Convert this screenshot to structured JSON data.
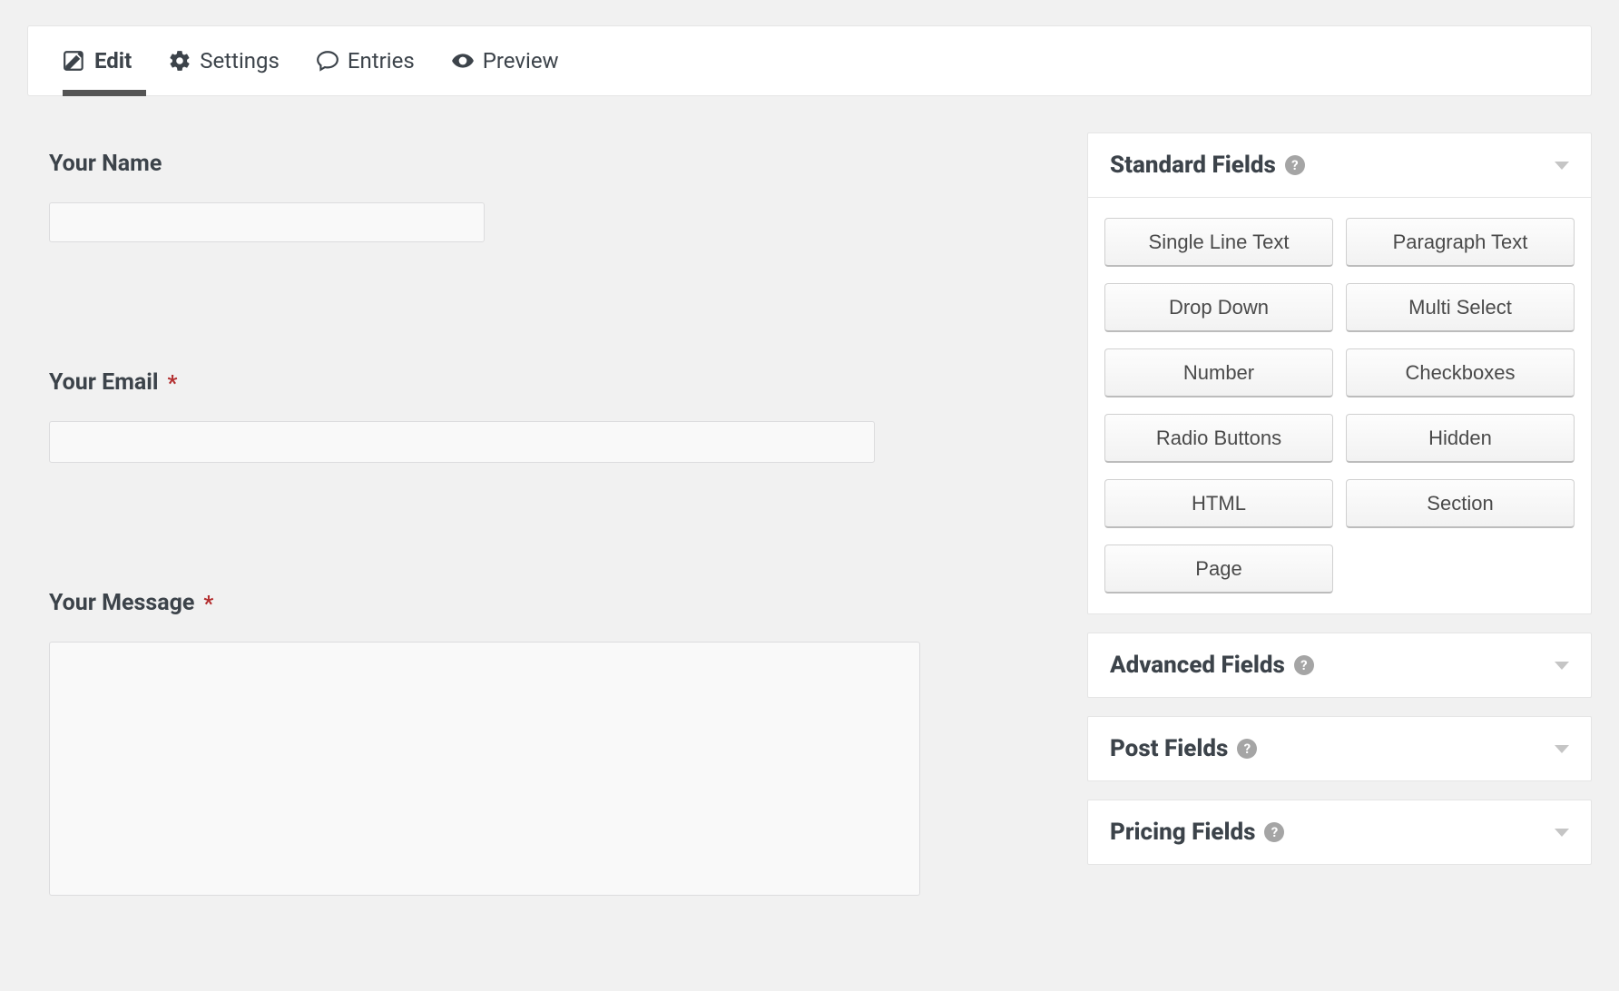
{
  "toolbar": {
    "edit": "Edit",
    "settings": "Settings",
    "entries": "Entries",
    "preview": "Preview"
  },
  "form": {
    "fields": [
      {
        "label": "Your Name",
        "required": false,
        "type": "text"
      },
      {
        "label": "Your Email",
        "required": true,
        "type": "email"
      },
      {
        "label": "Your Message",
        "required": true,
        "type": "textarea"
      }
    ],
    "required_mark": "*"
  },
  "sidebar": {
    "panels": [
      {
        "title": "Standard Fields",
        "expanded": true,
        "buttons": [
          "Single Line Text",
          "Paragraph Text",
          "Drop Down",
          "Multi Select",
          "Number",
          "Checkboxes",
          "Radio Buttons",
          "Hidden",
          "HTML",
          "Section",
          "Page"
        ]
      },
      {
        "title": "Advanced Fields",
        "expanded": false
      },
      {
        "title": "Post Fields",
        "expanded": false
      },
      {
        "title": "Pricing Fields",
        "expanded": false
      }
    ]
  }
}
